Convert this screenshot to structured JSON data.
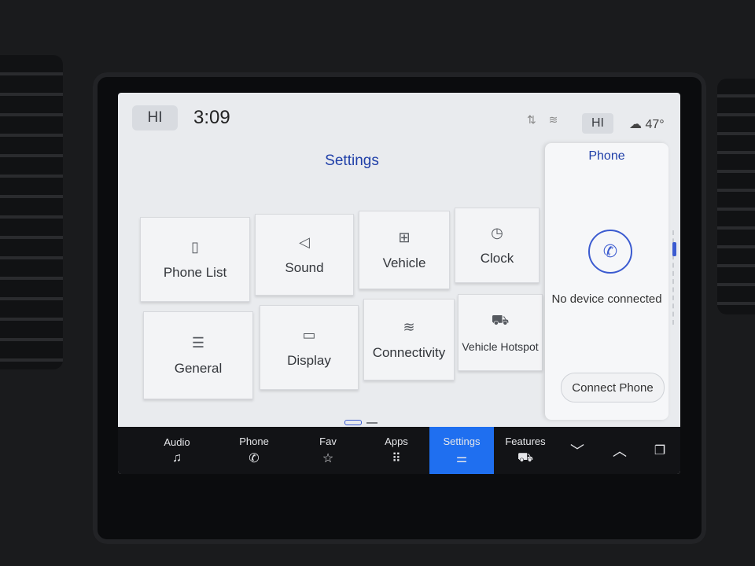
{
  "topbar": {
    "hi_left": "HI",
    "time": "3:09",
    "status_icons": "⇅ ≋",
    "hi_right": "HI",
    "weather": "☁ 47°"
  },
  "settings": {
    "title": "Settings",
    "tiles": [
      {
        "label": "Phone List",
        "icon": "▯"
      },
      {
        "label": "Sound",
        "icon": "◁"
      },
      {
        "label": "Vehicle",
        "icon": "⊞"
      },
      {
        "label": "Clock",
        "icon": "◷"
      },
      {
        "label": "General",
        "icon": "☰"
      },
      {
        "label": "Display",
        "icon": "▭"
      },
      {
        "label": "Connectivity",
        "icon": "≋"
      },
      {
        "label": "Vehicle Hotspot",
        "icon": "⛟"
      }
    ]
  },
  "phone_panel": {
    "title": "Phone",
    "icon": "✆",
    "status": "No device connected",
    "connect_label": "Connect Phone"
  },
  "nav": {
    "audio": {
      "label": "Audio",
      "icon": "♫"
    },
    "phone": {
      "label": "Phone",
      "icon": "✆"
    },
    "fav": {
      "label": "Fav",
      "icon": "☆"
    },
    "apps": {
      "label": "Apps",
      "icon": "⠿"
    },
    "settings": {
      "label": "Settings",
      "icon": "⚌"
    },
    "features": {
      "label": "Features",
      "icon": "⛟"
    },
    "down": {
      "icon": "﹀"
    },
    "up": {
      "icon": "︿"
    },
    "windows": {
      "icon": "❐"
    }
  }
}
